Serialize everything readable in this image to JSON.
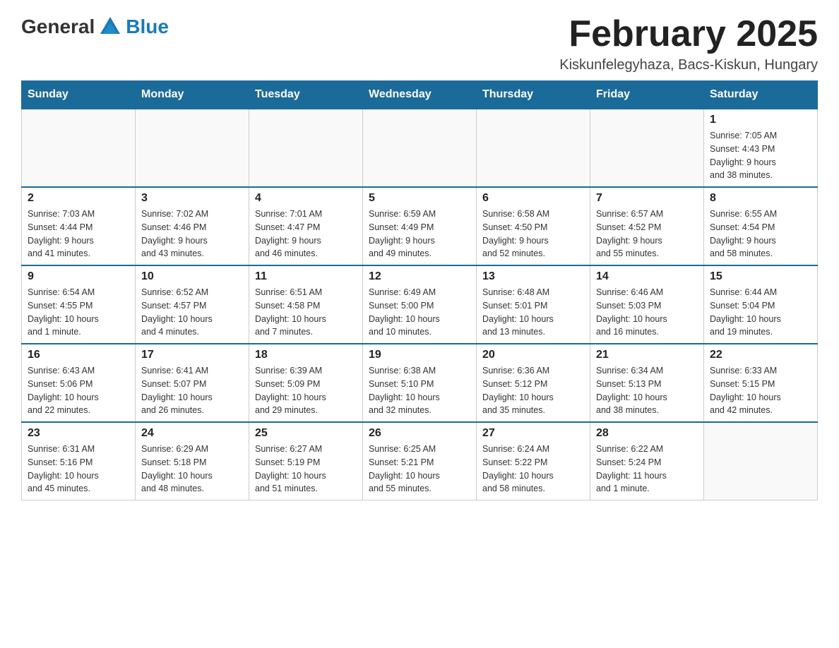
{
  "logo": {
    "general": "General",
    "blue": "Blue"
  },
  "title": "February 2025",
  "subtitle": "Kiskunfelegyhaza, Bacs-Kiskun, Hungary",
  "headers": [
    "Sunday",
    "Monday",
    "Tuesday",
    "Wednesday",
    "Thursday",
    "Friday",
    "Saturday"
  ],
  "weeks": [
    [
      {
        "day": "",
        "info": ""
      },
      {
        "day": "",
        "info": ""
      },
      {
        "day": "",
        "info": ""
      },
      {
        "day": "",
        "info": ""
      },
      {
        "day": "",
        "info": ""
      },
      {
        "day": "",
        "info": ""
      },
      {
        "day": "1",
        "info": "Sunrise: 7:05 AM\nSunset: 4:43 PM\nDaylight: 9 hours\nand 38 minutes."
      }
    ],
    [
      {
        "day": "2",
        "info": "Sunrise: 7:03 AM\nSunset: 4:44 PM\nDaylight: 9 hours\nand 41 minutes."
      },
      {
        "day": "3",
        "info": "Sunrise: 7:02 AM\nSunset: 4:46 PM\nDaylight: 9 hours\nand 43 minutes."
      },
      {
        "day": "4",
        "info": "Sunrise: 7:01 AM\nSunset: 4:47 PM\nDaylight: 9 hours\nand 46 minutes."
      },
      {
        "day": "5",
        "info": "Sunrise: 6:59 AM\nSunset: 4:49 PM\nDaylight: 9 hours\nand 49 minutes."
      },
      {
        "day": "6",
        "info": "Sunrise: 6:58 AM\nSunset: 4:50 PM\nDaylight: 9 hours\nand 52 minutes."
      },
      {
        "day": "7",
        "info": "Sunrise: 6:57 AM\nSunset: 4:52 PM\nDaylight: 9 hours\nand 55 minutes."
      },
      {
        "day": "8",
        "info": "Sunrise: 6:55 AM\nSunset: 4:54 PM\nDaylight: 9 hours\nand 58 minutes."
      }
    ],
    [
      {
        "day": "9",
        "info": "Sunrise: 6:54 AM\nSunset: 4:55 PM\nDaylight: 10 hours\nand 1 minute."
      },
      {
        "day": "10",
        "info": "Sunrise: 6:52 AM\nSunset: 4:57 PM\nDaylight: 10 hours\nand 4 minutes."
      },
      {
        "day": "11",
        "info": "Sunrise: 6:51 AM\nSunset: 4:58 PM\nDaylight: 10 hours\nand 7 minutes."
      },
      {
        "day": "12",
        "info": "Sunrise: 6:49 AM\nSunset: 5:00 PM\nDaylight: 10 hours\nand 10 minutes."
      },
      {
        "day": "13",
        "info": "Sunrise: 6:48 AM\nSunset: 5:01 PM\nDaylight: 10 hours\nand 13 minutes."
      },
      {
        "day": "14",
        "info": "Sunrise: 6:46 AM\nSunset: 5:03 PM\nDaylight: 10 hours\nand 16 minutes."
      },
      {
        "day": "15",
        "info": "Sunrise: 6:44 AM\nSunset: 5:04 PM\nDaylight: 10 hours\nand 19 minutes."
      }
    ],
    [
      {
        "day": "16",
        "info": "Sunrise: 6:43 AM\nSunset: 5:06 PM\nDaylight: 10 hours\nand 22 minutes."
      },
      {
        "day": "17",
        "info": "Sunrise: 6:41 AM\nSunset: 5:07 PM\nDaylight: 10 hours\nand 26 minutes."
      },
      {
        "day": "18",
        "info": "Sunrise: 6:39 AM\nSunset: 5:09 PM\nDaylight: 10 hours\nand 29 minutes."
      },
      {
        "day": "19",
        "info": "Sunrise: 6:38 AM\nSunset: 5:10 PM\nDaylight: 10 hours\nand 32 minutes."
      },
      {
        "day": "20",
        "info": "Sunrise: 6:36 AM\nSunset: 5:12 PM\nDaylight: 10 hours\nand 35 minutes."
      },
      {
        "day": "21",
        "info": "Sunrise: 6:34 AM\nSunset: 5:13 PM\nDaylight: 10 hours\nand 38 minutes."
      },
      {
        "day": "22",
        "info": "Sunrise: 6:33 AM\nSunset: 5:15 PM\nDaylight: 10 hours\nand 42 minutes."
      }
    ],
    [
      {
        "day": "23",
        "info": "Sunrise: 6:31 AM\nSunset: 5:16 PM\nDaylight: 10 hours\nand 45 minutes."
      },
      {
        "day": "24",
        "info": "Sunrise: 6:29 AM\nSunset: 5:18 PM\nDaylight: 10 hours\nand 48 minutes."
      },
      {
        "day": "25",
        "info": "Sunrise: 6:27 AM\nSunset: 5:19 PM\nDaylight: 10 hours\nand 51 minutes."
      },
      {
        "day": "26",
        "info": "Sunrise: 6:25 AM\nSunset: 5:21 PM\nDaylight: 10 hours\nand 55 minutes."
      },
      {
        "day": "27",
        "info": "Sunrise: 6:24 AM\nSunset: 5:22 PM\nDaylight: 10 hours\nand 58 minutes."
      },
      {
        "day": "28",
        "info": "Sunrise: 6:22 AM\nSunset: 5:24 PM\nDaylight: 11 hours\nand 1 minute."
      },
      {
        "day": "",
        "info": ""
      }
    ]
  ]
}
